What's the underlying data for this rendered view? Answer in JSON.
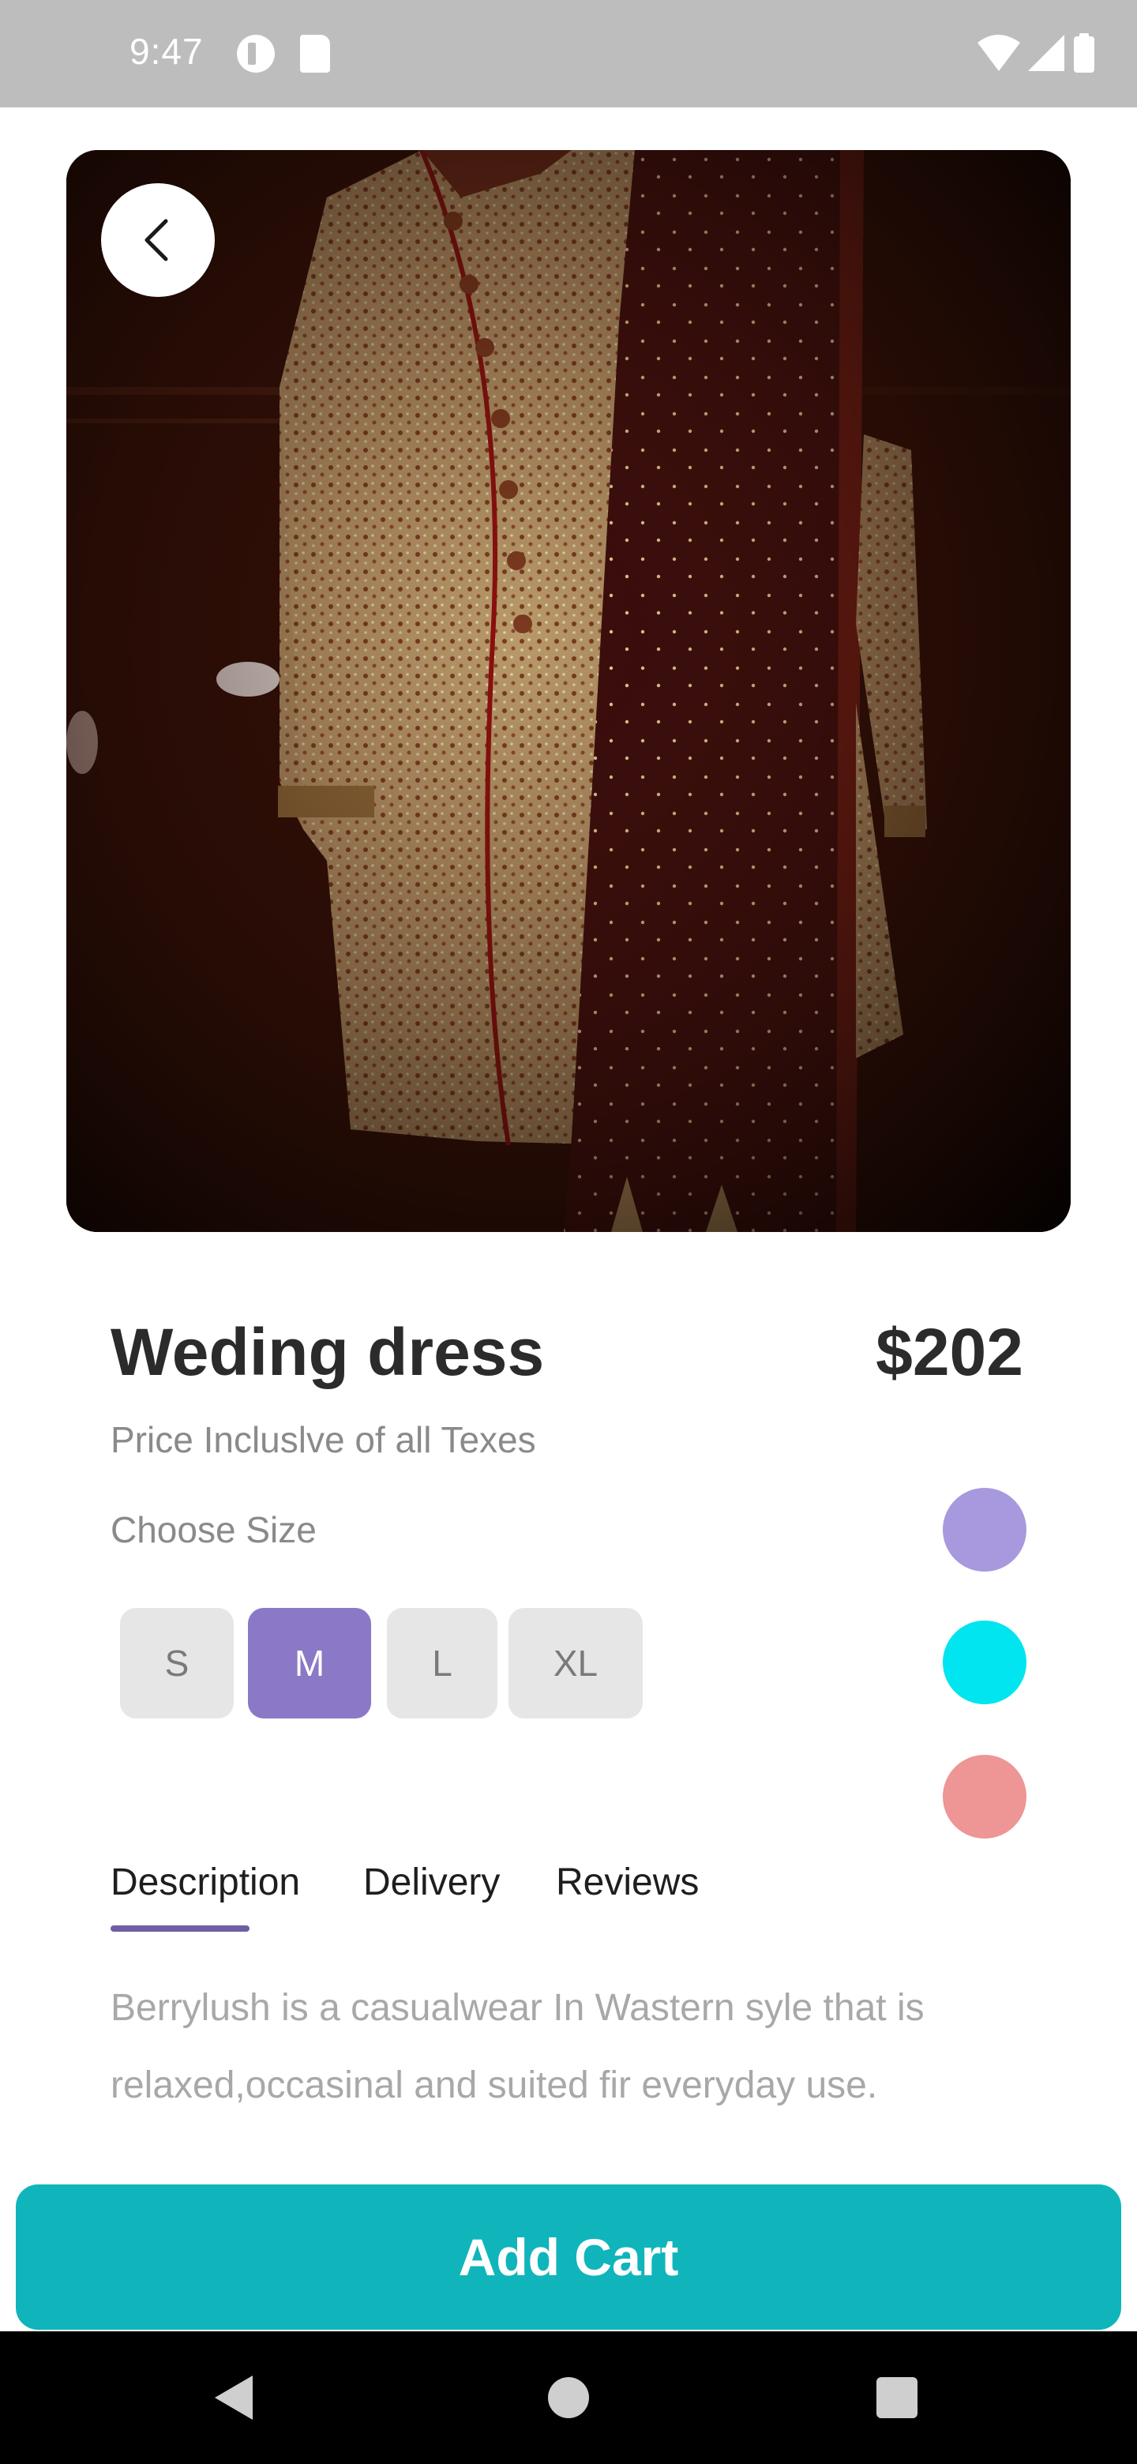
{
  "status_bar": {
    "time": "9:47",
    "icons": [
      "notification-icon",
      "sd-card-icon",
      "wifi-icon",
      "signal-icon",
      "battery-icon"
    ]
  },
  "hero": {
    "image": "product-photo-wedding-dress",
    "back_icon": "chevron-left-icon"
  },
  "product": {
    "title": "Weding dress",
    "price": "$202",
    "price_note": "Price Incluslve of all Texes",
    "size_label": "Choose Size",
    "sizes": [
      "S",
      "M",
      "L",
      "XL"
    ],
    "selected_size": "M",
    "colors": [
      "#a899de",
      "#00e5ef",
      "#ee9595"
    ]
  },
  "tabs": {
    "items": [
      "Description",
      "Delivery",
      "Reviews"
    ],
    "active": "Description"
  },
  "description": "Berrylush is a casualwear In Wastern syle that is relaxed,occasinal and suited fir everyday use.",
  "cta": {
    "label": "Add Cart",
    "color": "#0fb5bb"
  },
  "nav_bar": {
    "icons": [
      "back-icon",
      "home-icon",
      "recents-icon"
    ]
  }
}
